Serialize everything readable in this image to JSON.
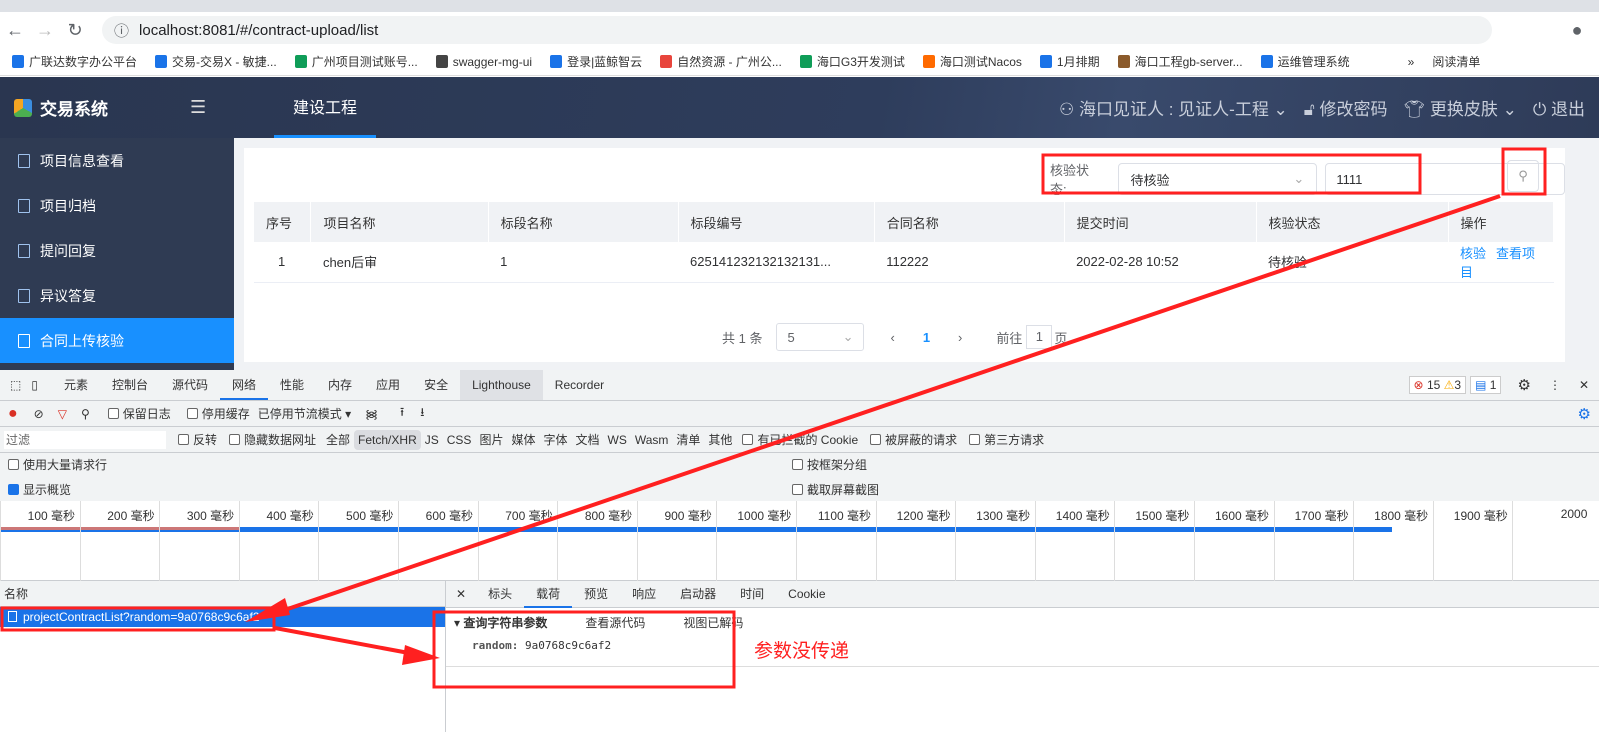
{
  "browser": {
    "url": "localhost:8081/#/contract-upload/list",
    "bookmarks": [
      "广联达数字办公平台",
      "交易-交易X - 敏捷...",
      "广州项目测试账号...",
      "swagger-mg-ui",
      "登录|蓝鲸智云",
      "自然资源 - 广州公...",
      "海口G3开发测试",
      "海口测试Nacos",
      "1月排期",
      "海口工程gb-server...",
      "运维管理系统"
    ],
    "bookmark_colors": [
      "#1a73e8",
      "#1a73e8",
      "#0f9d58",
      "#444444",
      "#1a73e8",
      "#e8453c",
      "#0f9d58",
      "#ff6a00",
      "#1a73e8",
      "#8b5a2b",
      "#1a73e8"
    ],
    "reading_list": "阅读清单"
  },
  "app": {
    "title": "交易系统",
    "top_tab": "建设工程",
    "user": "海口见证人 : 见证人-工程",
    "change_password": "修改密码",
    "change_skin": "更换皮肤",
    "logout": "退出"
  },
  "sidebar": {
    "items": [
      {
        "label": "项目信息查看"
      },
      {
        "label": "项目归档"
      },
      {
        "label": "提问回复"
      },
      {
        "label": "异议答复"
      },
      {
        "label": "合同上传核验",
        "active": true
      }
    ]
  },
  "filter": {
    "status_label": "核验状态:",
    "status_value": "待核验",
    "keyword_value": "1111"
  },
  "table": {
    "columns": [
      "序号",
      "项目名称",
      "标段名称",
      "标段编号",
      "合同名称",
      "提交时间",
      "核验状态",
      "操作"
    ],
    "rows": [
      {
        "no": "1",
        "project": "chen后审",
        "section": "1",
        "section_no": "625141232132132131...",
        "contract": "112222",
        "time": "2022-02-28 10:52",
        "status": "待核验",
        "actions": [
          "核验",
          "查看项目"
        ]
      }
    ]
  },
  "pagination": {
    "total": "共 1 条",
    "page_size": "5",
    "current": "1",
    "goto_prefix": "前往",
    "goto_value": "1",
    "goto_suffix": "页"
  },
  "devtools": {
    "tabs": [
      "元素",
      "控制台",
      "源代码",
      "网络",
      "性能",
      "内存",
      "应用",
      "安全",
      "Lighthouse",
      "Recorder"
    ],
    "active_tab": "网络",
    "errors": "15",
    "warnings": "3",
    "messages": "1",
    "toolbar": {
      "preserve_log": "保留日志",
      "disable_cache": "停用缓存",
      "throttle": "已停用节流模式"
    },
    "filter_placeholder": "过滤",
    "invert": "反转",
    "hide_data_urls": "隐藏数据网址",
    "types": [
      "全部",
      "Fetch/XHR",
      "JS",
      "CSS",
      "图片",
      "媒体",
      "字体",
      "文档",
      "WS",
      "Wasm",
      "清单",
      "其他"
    ],
    "active_type": "Fetch/XHR",
    "blocked_cookies": "有已拦截的 Cookie",
    "blocked_requests": "被屏蔽的请求",
    "third_party": "第三方请求",
    "big_rows": "使用大量请求行",
    "group_by_frame": "按框架分组",
    "show_overview": "显示概览",
    "screenshots": "截取屏幕截图",
    "timeline_ticks": [
      "100 毫秒",
      "200 毫秒",
      "300 毫秒",
      "400 毫秒",
      "500 毫秒",
      "600 毫秒",
      "700 毫秒",
      "800 毫秒",
      "900 毫秒",
      "1000 毫秒",
      "1100 毫秒",
      "1200 毫秒",
      "1300 毫秒",
      "1400 毫秒",
      "1500 毫秒",
      "1600 毫秒",
      "1700 毫秒",
      "1800 毫秒",
      "1900 毫秒",
      "2000"
    ],
    "name_header": "名称",
    "request": "projectContractList?random=9a0768c9c6af2",
    "detail_tabs": [
      "标头",
      "载荷",
      "预览",
      "响应",
      "启动器",
      "时间",
      "Cookie"
    ],
    "active_detail": "载荷",
    "payload": {
      "section": "查询字符串参数",
      "view_source": "查看源代码",
      "view_decoded": "视图已解码",
      "key": "random:",
      "value": "9a0768c9c6af2"
    }
  },
  "annotation": {
    "text": "参数没传递",
    "color": "#ff2020"
  }
}
